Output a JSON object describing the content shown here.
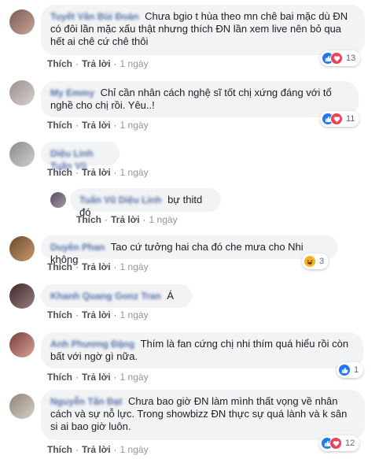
{
  "comments": [
    {
      "author": "Tuyết Vân Bùi Đoàn",
      "text": "Chưa bgio t hùa theo mn chê bai mặc dù ĐN có đôi lần mặc xấu thật nhưng thích ĐN lần xem live nên bỏ qua hết ai chê cứ chê thôi",
      "like": "Thích",
      "reply": "Trả lời",
      "time": "1 ngày",
      "reactions": [
        "like-icon",
        "love-icon"
      ],
      "reaction_count": "13"
    },
    {
      "author": "My Emmy",
      "text": "Chỉ cần nhân cách nghệ sĩ tốt chị xứng đáng với tổ nghề cho chị rồi. Yêu..!",
      "like": "Thích",
      "reply": "Trả lời",
      "time": "1 ngày",
      "reactions": [
        "like-icon",
        "love-icon"
      ],
      "reaction_count": "11"
    },
    {
      "author": "Diệu Linh Tuấn Vũ",
      "text": "",
      "like": "Thích",
      "reply": "Trả lời",
      "time": "1 ngày"
    },
    {
      "author": "Tuấn Vũ Diệu Linh",
      "text": "bự thitd đó",
      "like": "Thích",
      "reply": "Trả lời",
      "time": "1 ngày"
    },
    {
      "author": "Duyên Phan",
      "text": "Tao cứ tưởng hai cha đó che mưa cho Nhi không",
      "like": "Thích",
      "reply": "Trả lời",
      "time": "1 ngày",
      "reactions": [
        "haha-icon"
      ],
      "reaction_count": "3"
    },
    {
      "author": "Khanh Quang Gonz Tran",
      "text": "Á",
      "like": "Thích",
      "reply": "Trả lời",
      "time": "1 ngày"
    },
    {
      "author": "Anh Phương Đặng",
      "text": "Thím là fan cứng chị nhi thím quá hiểu rồi còn bất với ngờ gì nữa.",
      "like": "Thích",
      "reply": "Trả lời",
      "time": "1 ngày",
      "reactions": [
        "like-icon"
      ],
      "reaction_count": "1"
    },
    {
      "author": "Nguyễn Tấn Đạt",
      "text": "Chưa bao giờ ĐN làm mình thất vọng về nhân cách và sự nỗ lực. Trong showbizz ĐN thực sự quá lành và k sân si ai bao giờ luôn.",
      "like": "Thích",
      "reply": "Trả lời",
      "time": "1 ngày",
      "reactions": [
        "like-icon",
        "love-icon"
      ],
      "reaction_count": "12"
    }
  ],
  "colors": {
    "link": "#385898",
    "bubble": "#f2f3f5",
    "like": "#2078f4",
    "love": "#f33e58",
    "haha": "#f7b125",
    "meta": "#606770"
  }
}
